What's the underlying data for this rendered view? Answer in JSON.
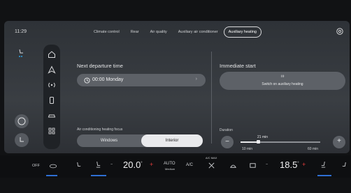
{
  "topbar": {
    "time": "11:29",
    "tabs": [
      {
        "label": "Climate control"
      },
      {
        "label": "Rear"
      },
      {
        "label": "Air quality"
      },
      {
        "label": "Auxiliary air conditioner"
      },
      {
        "label": "Auxiliary heating"
      }
    ],
    "active_tab": "Auxiliary heating"
  },
  "departure": {
    "title": "Next departure time",
    "value": "00:00 Monday",
    "chevron": "›"
  },
  "focus": {
    "title": "Air conditioning heating focus",
    "options": [
      "Windows",
      "Interior"
    ],
    "selected": "Interior"
  },
  "immediate": {
    "title": "Immediate start",
    "button_label": "Switch on auxiliary heating"
  },
  "duration": {
    "title": "Duration",
    "value_label": "21 min",
    "min_label": "10 min",
    "max_label": "60 min",
    "minus": "−",
    "plus": "+",
    "value": 21,
    "min": 10,
    "max": 60
  },
  "climate": {
    "off_label": "OFF",
    "left_temp": "20.0",
    "right_temp": "18.5",
    "unit": "°",
    "plus": "+",
    "auto_label": "AUTO",
    "auto_sub": "Medium",
    "ac_label": "A/C",
    "ac_max_label": "A/C MAX"
  },
  "colors": {
    "accent": "#2f6fd4",
    "temp_plus": "#e23c3c",
    "seat_dots": "#2fa3e6"
  }
}
